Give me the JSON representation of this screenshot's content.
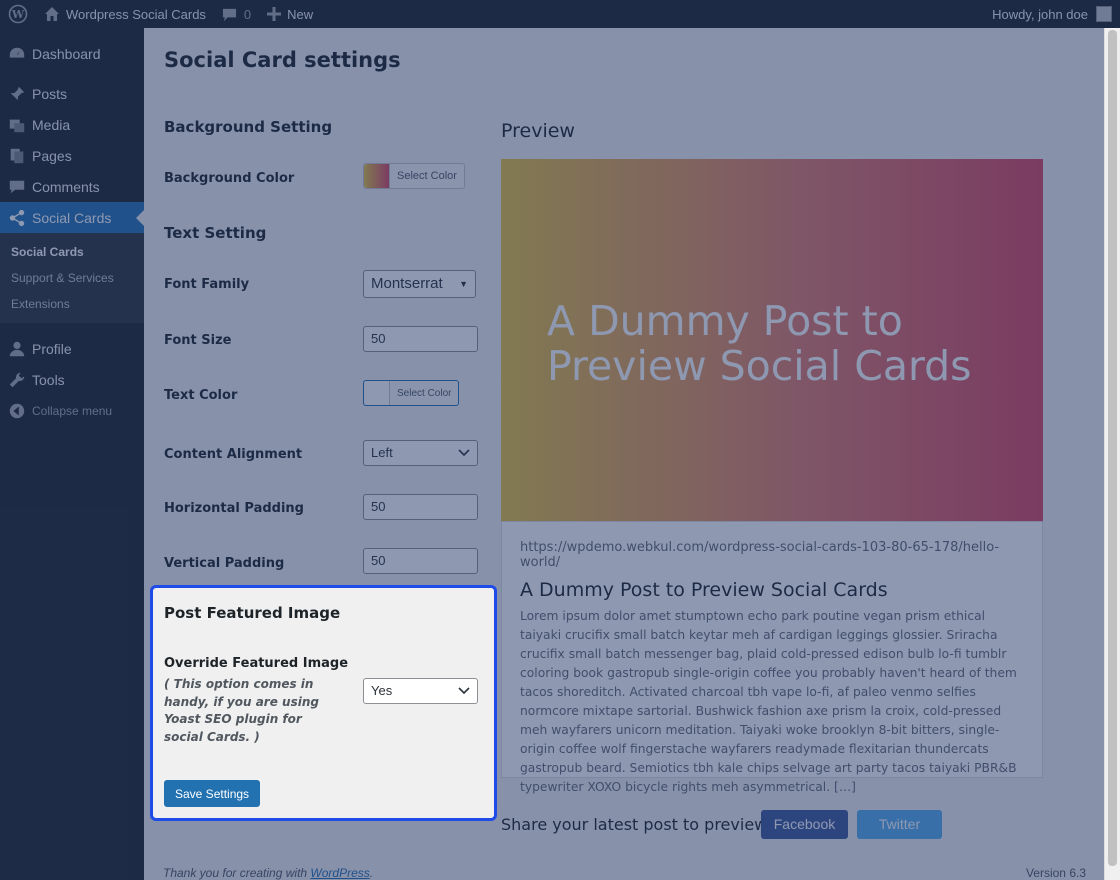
{
  "adminbar": {
    "site_name": "Wordpress Social Cards",
    "comments_count": "0",
    "new_label": "New",
    "howdy": "Howdy, john doe"
  },
  "sidebar": {
    "items": [
      {
        "label": "Dashboard",
        "icon": "dashboard-icon"
      },
      {
        "label": "Posts",
        "icon": "pin-icon"
      },
      {
        "label": "Media",
        "icon": "media-icon"
      },
      {
        "label": "Pages",
        "icon": "pages-icon"
      },
      {
        "label": "Comments",
        "icon": "comment-icon"
      },
      {
        "label": "Social Cards",
        "icon": "share-icon"
      }
    ],
    "submenu": [
      "Social Cards",
      "Support & Services",
      "Extensions"
    ],
    "bottom": [
      {
        "label": "Profile",
        "icon": "user-icon"
      },
      {
        "label": "Tools",
        "icon": "wrench-icon"
      }
    ],
    "collapse_label": "Collapse menu"
  },
  "page": {
    "title": "Social Card settings"
  },
  "settings": {
    "background_section": "Background Setting",
    "background_color_label": "Background Color",
    "select_color": "Select Color",
    "text_section": "Text Setting",
    "font_family_label": "Font Family",
    "font_family_value": "Montserrat",
    "font_size_label": "Font Size",
    "font_size_value": "50",
    "text_color_label": "Text Color",
    "content_alignment_label": "Content Alignment",
    "content_alignment_value": "Left",
    "horizontal_padding_label": "Horizontal Padding",
    "horizontal_padding_value": "50",
    "vertical_padding_label": "Vertical Padding",
    "vertical_padding_value": "50",
    "featured_section": "Post Featured Image",
    "override_label": "Override Featured Image",
    "override_note": "( This option comes in handy, if you are using Yoast SEO plugin for social Cards. )",
    "override_value": "Yes",
    "save_label": "Save Settings"
  },
  "preview": {
    "title": "Preview",
    "headline": "A Dummy Post to Preview Social Cards",
    "url": "https://wpdemo.webkul.com/wordpress-social-cards-103-80-65-178/hello-world/",
    "post_title": "A Dummy Post to Preview Social Cards",
    "excerpt": "Lorem ipsum dolor amet stumptown echo park poutine vegan prism ethical taiyaki crucifix small batch keytar meh af cardigan leggings glossier. Sriracha crucifix small batch messenger bag, plaid cold-pressed edison bulb lo-fi tumblr coloring book gastropub single-origin coffee you probably haven't heard of them tacos shoreditch. Activated charcoal tbh vape lo-fi, af paleo venmo selfies normcore mixtape sartorial. Bushwick fashion axe prism la croix, cold-pressed meh wayfarers unicorn meditation. Taiyaki woke brooklyn 8-bit bitters, single-origin coffee wolf fingerstache wayfarers readymade flexitarian thundercats gastropub beard. Semiotics tbh kale chips selvage art party tacos taiyaki PBR&B typewriter XOXO bicycle rights meh asymmetrical. […]",
    "share_text": "Share your latest post to preview",
    "facebook": "Facebook",
    "twitter": "Twitter"
  },
  "footer": {
    "thanks_prefix": "Thank you for creating with ",
    "wordpress_link": "WordPress",
    "thanks_suffix": ".",
    "version": "Version 6.3"
  },
  "colors": {
    "accent": "#2271b1",
    "sidebar_bg": "#1d2327",
    "highlight_border": "#1f4be8",
    "facebook": "#3b5998",
    "twitter": "#55acee"
  }
}
